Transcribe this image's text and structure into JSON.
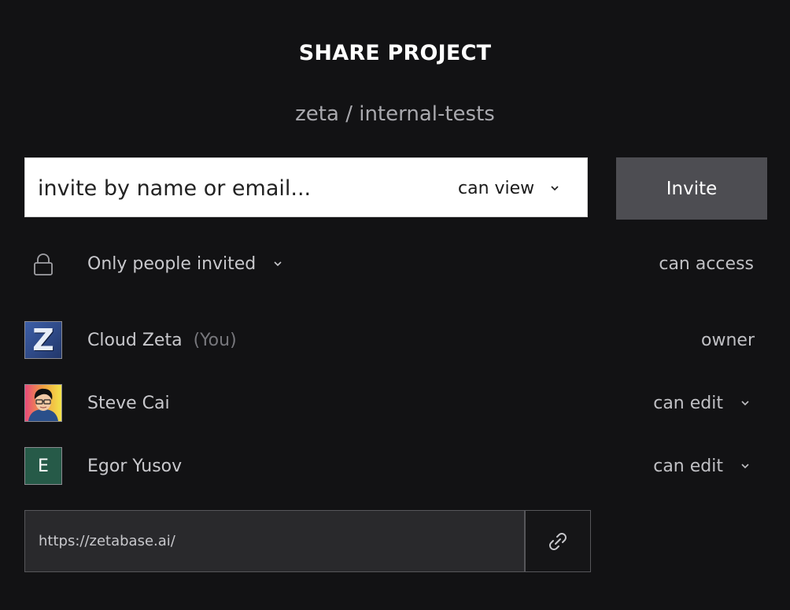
{
  "dialog": {
    "title": "SHARE PROJECT",
    "subtitle": "zeta / internal-tests"
  },
  "invite": {
    "placeholder": "invite by name or email...",
    "value": "",
    "permission": "can view",
    "button_label": "Invite"
  },
  "general_access": {
    "icon": "lock-icon",
    "scope": "Only people invited",
    "right_label": "can access"
  },
  "members": [
    {
      "name": "Cloud Zeta",
      "tag": "(You)",
      "role": "owner",
      "avatar": "Z",
      "role_editable": false
    },
    {
      "name": "Steve Cai",
      "tag": "",
      "role": "can edit",
      "avatar": "photo",
      "role_editable": true
    },
    {
      "name": "Egor Yusov",
      "tag": "",
      "role": "can edit",
      "avatar": "E",
      "role_editable": true
    }
  ],
  "share_link": {
    "url": "https://zetabase.ai/",
    "copy_icon": "link-icon"
  },
  "colors": {
    "background": "#121214",
    "invite_button": "#4d4d52",
    "egor_avatar": "#265a48"
  }
}
